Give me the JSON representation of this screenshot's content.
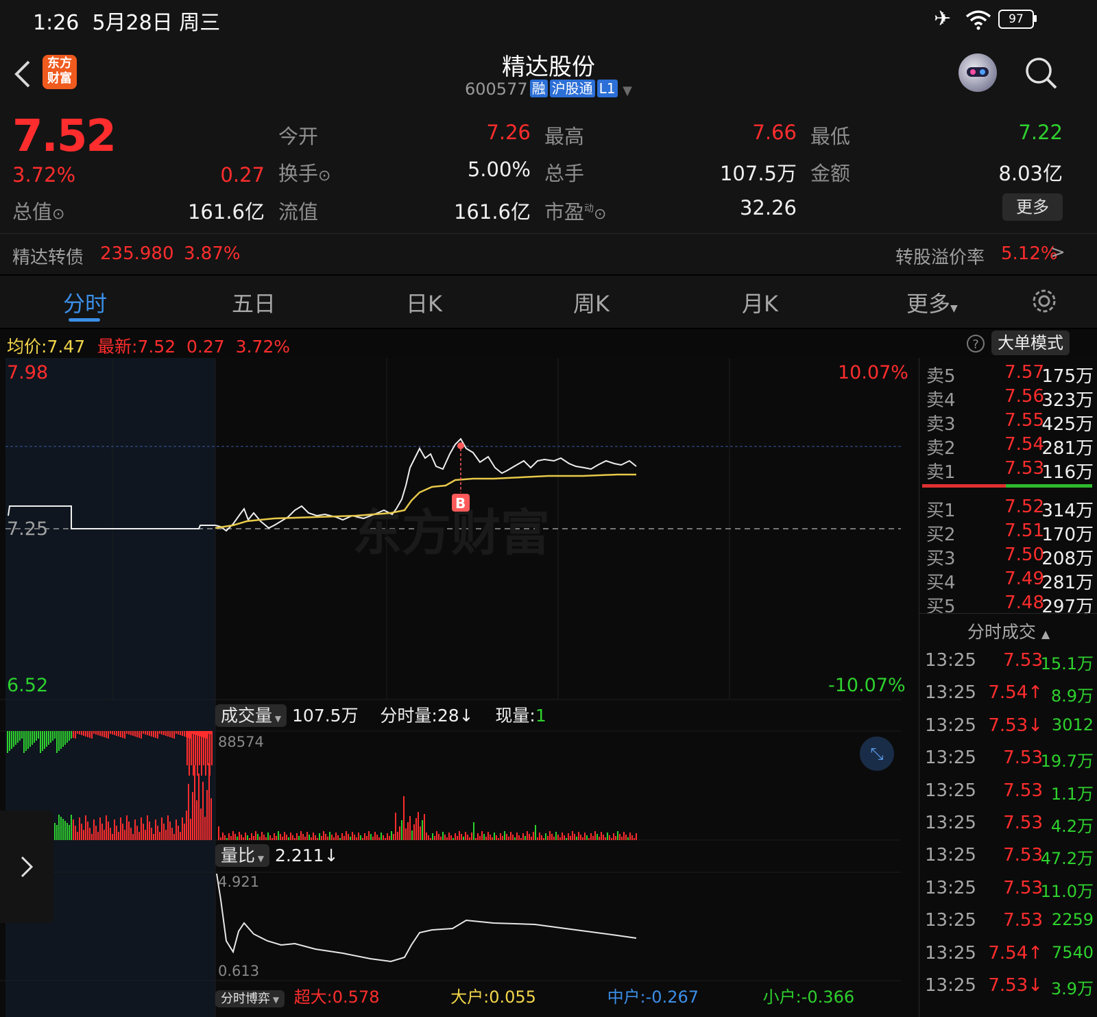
{
  "status_bar": {
    "time": "1:26",
    "date": "5月28日",
    "weekday": "周三",
    "battery": "97"
  },
  "header": {
    "logo_text": "东方\n财富",
    "stock_name": "精达股份",
    "stock_code": "600577",
    "tags": [
      "融",
      "沪股通",
      "L1"
    ]
  },
  "quote": {
    "price": "7.52",
    "change_pct": "3.72%",
    "change": "0.27",
    "total_value_label": "总值",
    "total_value": "161.6亿",
    "open_label": "今开",
    "open": "7.26",
    "high_label": "最高",
    "high": "7.66",
    "low_label": "最低",
    "low": "7.22",
    "turnover_label": "换手",
    "turnover": "5.00%",
    "volume_label": "总手",
    "volume": "107.5万",
    "amount_label": "金额",
    "amount": "8.03亿",
    "float_value_label": "流值",
    "float_value": "161.6亿",
    "pe_label": "市盈",
    "pe_sup": "动",
    "pe": "32.26",
    "more_button": "更多"
  },
  "bond": {
    "name": "精达转债",
    "price": "235.980",
    "change_pct": "3.87%",
    "premium_label": "转股溢价率",
    "premium": "5.12%"
  },
  "tabs": [
    "分时",
    "五日",
    "日K",
    "周K",
    "月K",
    "更多"
  ],
  "infobar": {
    "avg_label": "均价:",
    "avg": "7.47",
    "latest_label": "最新:",
    "latest": "7.52",
    "change": "0.27",
    "change_pct": "3.72%",
    "mode_button": "大单模式"
  },
  "chart": {
    "y_top": "7.98",
    "y_top_pct": "10.07%",
    "y_mid": "7.25",
    "y_bottom": "6.52",
    "y_bottom_pct": "-10.07%",
    "watermark": "东方财富",
    "marker": "B"
  },
  "volume_panel": {
    "selector": "成交量",
    "total": "107.5万",
    "minute_label": "分时量:",
    "minute_value": "28",
    "current_label": "现量:",
    "current_value": "1",
    "max_label": "88574"
  },
  "ratio_panel": {
    "selector": "量比",
    "value": "2.211",
    "max_label": "4.921",
    "min_label": "0.613"
  },
  "bottom_bar": {
    "selector": "分时博弈",
    "items": [
      "超大:0.578",
      "大户:0.055",
      "中户:-0.267",
      "小户:-0.366"
    ]
  },
  "orderbook": {
    "asks": [
      {
        "label": "卖5",
        "price": "7.57",
        "vol": "175万"
      },
      {
        "label": "卖4",
        "price": "7.56",
        "vol": "323万"
      },
      {
        "label": "卖3",
        "price": "7.55",
        "vol": "425万"
      },
      {
        "label": "卖2",
        "price": "7.54",
        "vol": "281万"
      },
      {
        "label": "卖1",
        "price": "7.53",
        "vol": "116万"
      }
    ],
    "bids": [
      {
        "label": "买1",
        "price": "7.52",
        "vol": "314万"
      },
      {
        "label": "买2",
        "price": "7.51",
        "vol": "170万"
      },
      {
        "label": "买3",
        "price": "7.50",
        "vol": "208万"
      },
      {
        "label": "买4",
        "price": "7.49",
        "vol": "281万"
      },
      {
        "label": "买5",
        "price": "7.48",
        "vol": "297万"
      }
    ],
    "trades_title": "分时成交",
    "trades": [
      {
        "time": "13:25",
        "price": "7.53",
        "vol": "15.1万"
      },
      {
        "time": "13:25",
        "price": "7.54↑",
        "vol": "8.9万"
      },
      {
        "time": "13:25",
        "price": "7.53↓",
        "vol": "3012"
      },
      {
        "time": "13:25",
        "price": "7.53",
        "vol": "19.7万"
      },
      {
        "time": "13:25",
        "price": "7.53",
        "vol": "1.1万"
      },
      {
        "time": "13:25",
        "price": "7.53",
        "vol": "4.2万"
      },
      {
        "time": "13:25",
        "price": "7.53",
        "vol": "47.2万"
      },
      {
        "time": "13:25",
        "price": "7.53",
        "vol": "11.0万"
      },
      {
        "time": "13:25",
        "price": "7.53",
        "vol": "2259"
      },
      {
        "time": "13:25",
        "price": "7.54↑",
        "vol": "7540"
      },
      {
        "time": "13:25",
        "price": "7.53↓",
        "vol": "3.9万"
      }
    ]
  },
  "colors": {
    "up": "#ff2d2d",
    "down": "#2ed12e",
    "accent": "#3b8fe8",
    "avg_line": "#e8c94a"
  }
}
